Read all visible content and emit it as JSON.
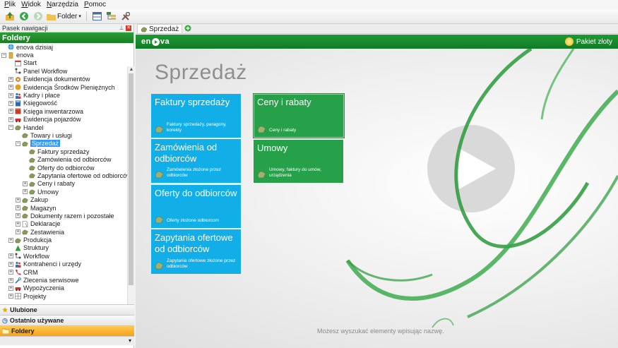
{
  "menu": [
    "Plik",
    "Widok",
    "Narzędzia",
    "Pomoc"
  ],
  "toolbar": {
    "folder_label": "Folder",
    "icons": [
      "up-folder-icon",
      "back-icon",
      "forward-icon",
      "folder-icon",
      "table-icon",
      "tree-icon",
      "tools-icon"
    ]
  },
  "nav": {
    "caption": "Pasek nawigacji",
    "header": "Foldery",
    "tree": [
      {
        "label": "enova dzisiaj",
        "level": 0,
        "exp": "",
        "icon": "globe"
      },
      {
        "label": "enova",
        "level": 0,
        "exp": "-",
        "icon": "db"
      },
      {
        "label": "Start",
        "level": 1,
        "exp": "",
        "icon": "calendar"
      },
      {
        "label": "Panel Workflow",
        "level": 1,
        "exp": "",
        "icon": "flow"
      },
      {
        "label": "Ewidencja dokumentów",
        "level": 1,
        "exp": "+",
        "icon": "gear"
      },
      {
        "label": "Ewidencja Środków Pieniężnych",
        "level": 1,
        "exp": "+",
        "icon": "coin"
      },
      {
        "label": "Kadry i płace",
        "level": 1,
        "exp": "+",
        "icon": "people"
      },
      {
        "label": "Księgowość",
        "level": 1,
        "exp": "+",
        "icon": "book"
      },
      {
        "label": "Księga inwentarzowa",
        "level": 1,
        "exp": "+",
        "icon": "box"
      },
      {
        "label": "Ewidencja pojazdów",
        "level": 1,
        "exp": "+",
        "icon": "car"
      },
      {
        "label": "Handel",
        "level": 1,
        "exp": "-",
        "icon": "hand"
      },
      {
        "label": "Towary i usługi",
        "level": 2,
        "exp": "",
        "icon": "hand"
      },
      {
        "label": "Sprzedaż",
        "level": 2,
        "exp": "-",
        "icon": "hand",
        "selected": true
      },
      {
        "label": "Faktury sprzedaży",
        "level": 3,
        "exp": "",
        "icon": "hand"
      },
      {
        "label": "Zamówienia od odbiorców",
        "level": 3,
        "exp": "",
        "icon": "hand"
      },
      {
        "label": "Oferty do odbiorców",
        "level": 3,
        "exp": "",
        "icon": "hand"
      },
      {
        "label": "Zapytania ofertowe od odbiorców",
        "level": 3,
        "exp": "",
        "icon": "hand"
      },
      {
        "label": "Ceny i rabaty",
        "level": 3,
        "exp": "+",
        "icon": "hand"
      },
      {
        "label": "Umowy",
        "level": 3,
        "exp": "+",
        "icon": "hand"
      },
      {
        "label": "Zakup",
        "level": 2,
        "exp": "+",
        "icon": "hand"
      },
      {
        "label": "Magazyn",
        "level": 2,
        "exp": "+",
        "icon": "hand"
      },
      {
        "label": "Dokumenty razem i pozostałe",
        "level": 2,
        "exp": "+",
        "icon": "hand"
      },
      {
        "label": "Deklaracje",
        "level": 2,
        "exp": "+",
        "icon": "doc"
      },
      {
        "label": "Zestawienia",
        "level": 2,
        "exp": "+",
        "icon": "hand"
      },
      {
        "label": "Produkcja",
        "level": 1,
        "exp": "+",
        "icon": "hand"
      },
      {
        "label": "Struktury",
        "level": 1,
        "exp": "",
        "icon": "tree"
      },
      {
        "label": "Workflow",
        "level": 1,
        "exp": "+",
        "icon": "flow"
      },
      {
        "label": "Kontrahenci i urzędy",
        "level": 1,
        "exp": "+",
        "icon": "people"
      },
      {
        "label": "CRM",
        "level": 1,
        "exp": "+",
        "icon": "phone"
      },
      {
        "label": "Zlecenia serwisowe",
        "level": 1,
        "exp": "+",
        "icon": "wrench"
      },
      {
        "label": "Wypożyczenia",
        "level": 1,
        "exp": "+",
        "icon": "car"
      },
      {
        "label": "Projekty",
        "level": 1,
        "exp": "+",
        "icon": "grid"
      }
    ],
    "bottom": [
      {
        "label": "Ulubione",
        "icon": "star"
      },
      {
        "label": "Ostatnio używane",
        "icon": "clock"
      },
      {
        "label": "Foldery",
        "icon": "folder",
        "active": true
      }
    ]
  },
  "tab": {
    "label": "Sprzedaż"
  },
  "brand": {
    "logo_left": "en",
    "logo_right": "va",
    "package": "Pakiet złoty"
  },
  "page": {
    "title": "Sprzedaż",
    "hint": "Możesz wyszukać elementy wpisując nazwę.",
    "tiles": [
      {
        "title": "Faktury sprzedaży",
        "sub": "Faktury sprzedaży, paragony, korekty",
        "color": "#12aee8"
      },
      {
        "title": "Zamówienia od odbiorców",
        "sub": "Zamówienia złożone przez odbiorców",
        "color": "#12aee8"
      },
      {
        "title": "Oferty do odbiorców",
        "sub": "Oferty złożone odbiorcom",
        "color": "#12aee8"
      },
      {
        "title": "Zapytania ofertowe od odbiorców",
        "sub": "Zapytania ofertowe złożone przez odbiorców",
        "color": "#12aee8"
      },
      {
        "title": "Ceny i rabaty",
        "sub": "Ceny i rabaty",
        "color": "#26a14a"
      },
      {
        "title": "Umowy",
        "sub": "Umowy, faktury do umów, urządzenia",
        "color": "#26a14a"
      }
    ]
  },
  "colors": {
    "brand_green": "#1f9a35",
    "tile_blue": "#12aee8",
    "tile_green": "#26a14a",
    "selection": "#3399ff"
  }
}
